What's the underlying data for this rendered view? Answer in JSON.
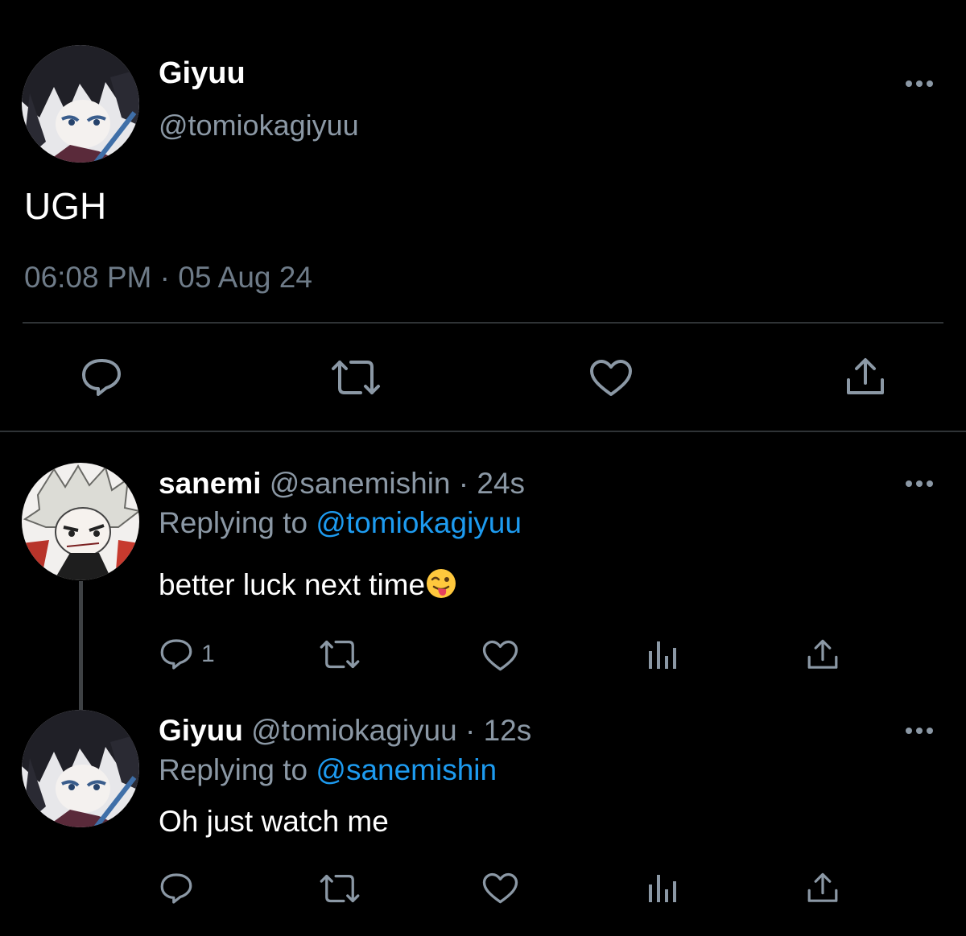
{
  "main_tweet": {
    "display_name": "Giyuu",
    "handle": "@tomiokagiyuu",
    "text": "UGH",
    "timestamp": "06:08 PM · 05 Aug 24",
    "actions": [
      "reply-icon",
      "retweet-icon",
      "like-icon",
      "share-icon"
    ]
  },
  "replies": [
    {
      "display_name": "sanemi",
      "handle": "@sanemishin",
      "separator": "·",
      "time": "24s",
      "replying_prefix": "Replying to",
      "replying_to": "@tomiokagiyuu",
      "text": "better luck next time",
      "emoji": "winking-face-with-tongue",
      "reply_count": "1"
    },
    {
      "display_name": "Giyuu",
      "handle": "@tomiokagiyuu",
      "separator": "·",
      "time": "12s",
      "replying_prefix": "Replying to",
      "replying_to": "@sanemishin",
      "text": "Oh just watch me",
      "reply_count": ""
    }
  ],
  "colors": {
    "background": "#000000",
    "text_primary": "#ffffff",
    "text_secondary": "#8b98a5",
    "link": "#1d9bf0",
    "divider": "#2f3336",
    "icon": "#8b98a5"
  }
}
